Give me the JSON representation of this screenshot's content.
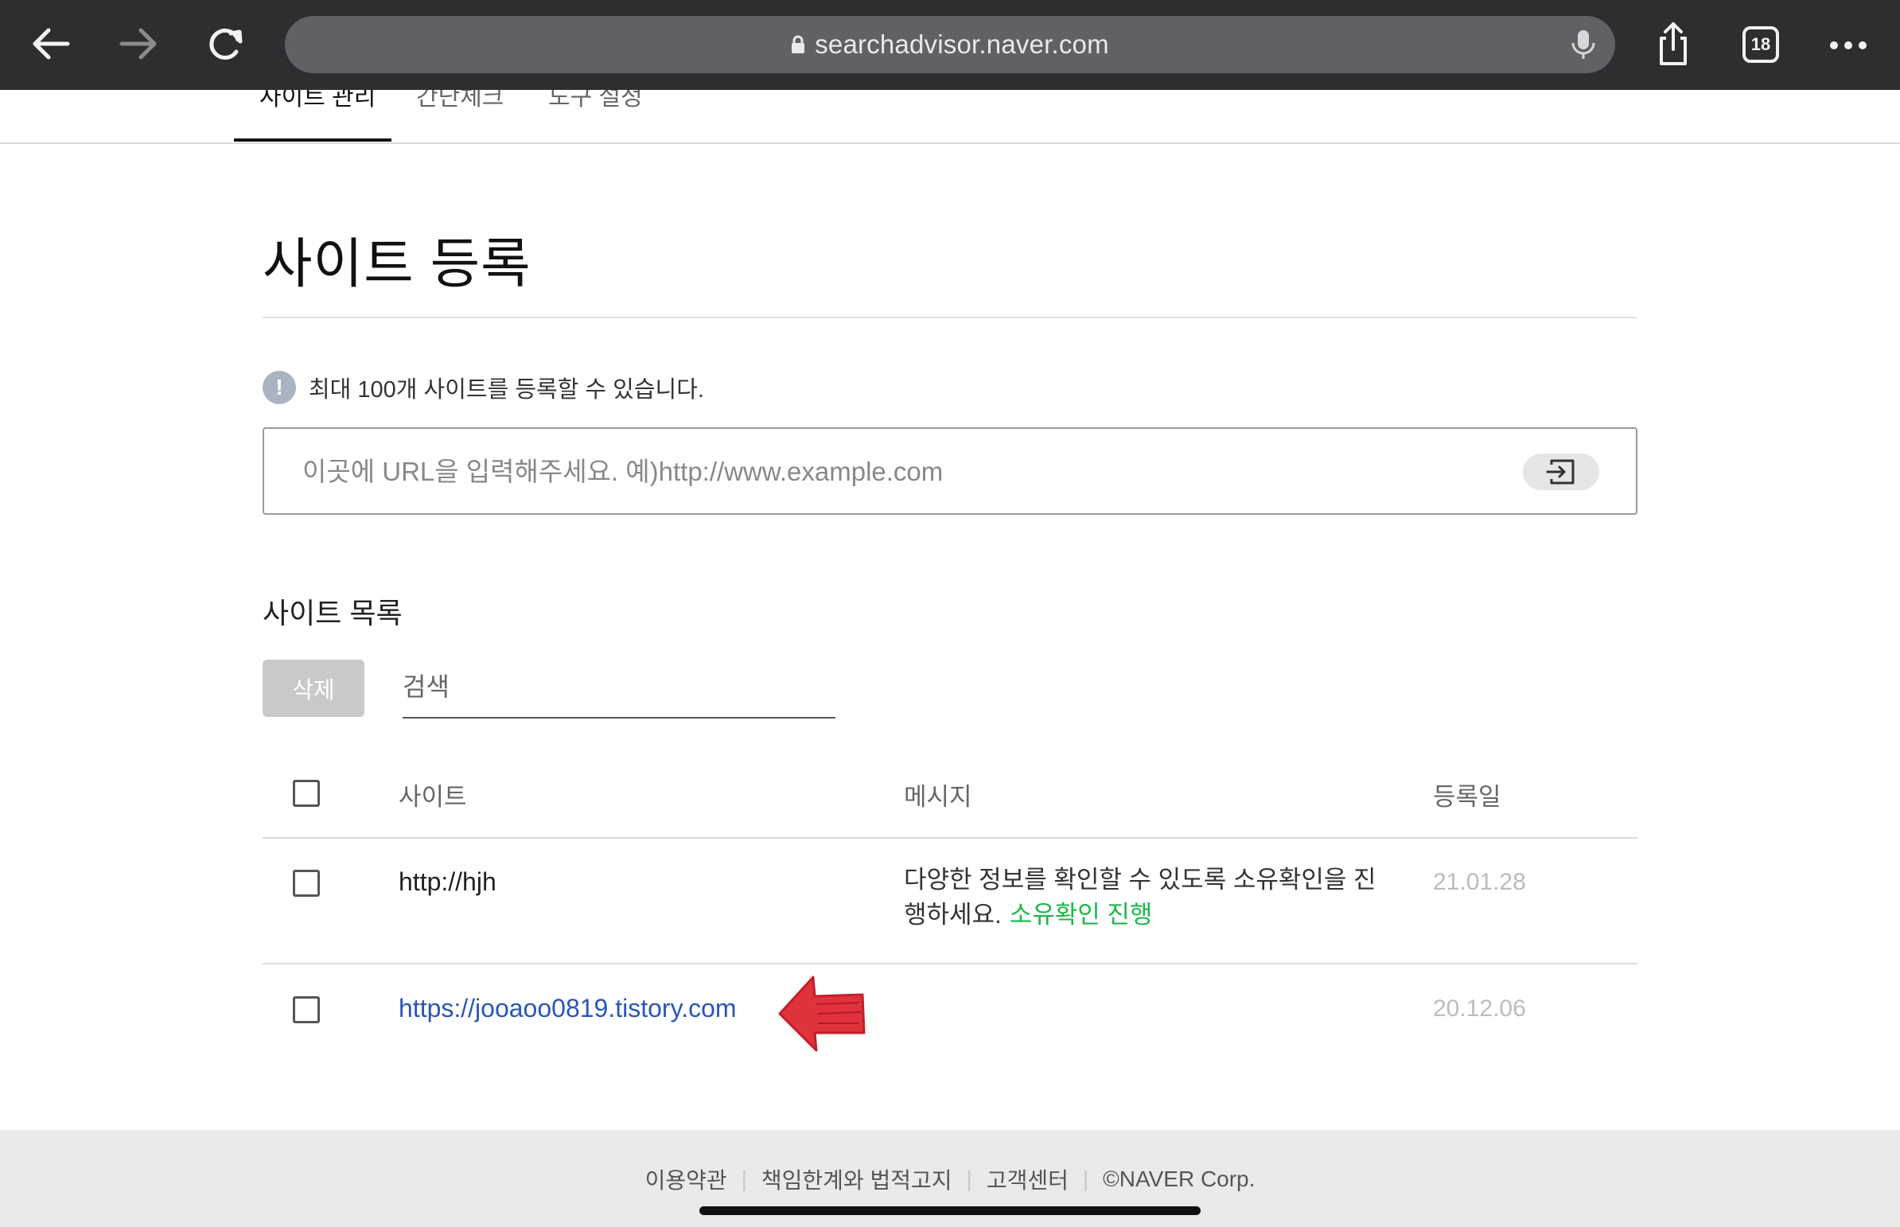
{
  "browser": {
    "url": "searchadvisor.naver.com",
    "tab_count": "18",
    "icons": [
      "back-icon",
      "forward-icon",
      "reload-icon",
      "lock-icon",
      "microphone-icon",
      "share-icon",
      "tabs-icon",
      "more-icon"
    ]
  },
  "nav": {
    "tabs": [
      {
        "label": "사이트 관리",
        "active": true
      },
      {
        "label": "간단체크",
        "active": false
      },
      {
        "label": "도구 설정",
        "active": false
      }
    ]
  },
  "page": {
    "title": "사이트 등록",
    "notice": "최대 100개 사이트를 등록할 수 있습니다.",
    "notice_icon": "!",
    "url_input": {
      "placeholder": "이곳에 URL을 입력해주세요. 예)http://www.example.com",
      "value": ""
    }
  },
  "site_list": {
    "title": "사이트 목록",
    "delete_label": "삭제",
    "search_placeholder": "검색",
    "columns": [
      "사이트",
      "메시지",
      "등록일"
    ],
    "rows": [
      {
        "site": "http://hjh",
        "message": "다양한 정보를 확인할 수 있도록 소유확인을 진행하세요.",
        "action": "소유확인 진행",
        "date": "21.01.28",
        "checked": false
      },
      {
        "site": "https://jooaoo0819.tistory.com",
        "message": "",
        "action": "",
        "date": "20.12.06",
        "checked": false
      }
    ]
  },
  "footer": {
    "links": [
      "이용약관",
      "책임한계와 법적고지",
      "고객센터"
    ],
    "copyright": "©NAVER Corp."
  },
  "colors": {
    "toolbar_bg": "#2d2e30",
    "urlbar_bg": "#5f6164",
    "link_blue": "#2a56b6",
    "action_green": "#1eb74a",
    "annotation_red": "#e0323a"
  }
}
